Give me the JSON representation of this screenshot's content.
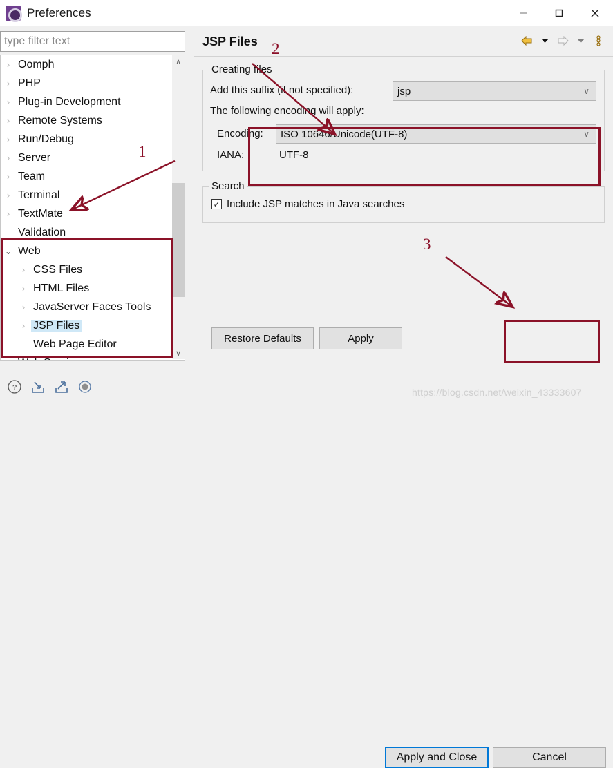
{
  "window": {
    "title": "Preferences",
    "icon": "preferences-gear-icon",
    "controls": {
      "minimize": "–",
      "maximize": "□",
      "close": "×"
    }
  },
  "filter": {
    "placeholder": "type filter text",
    "value": ""
  },
  "tree": {
    "items": [
      {
        "label": "Oomph",
        "level": 0,
        "arrow": "right",
        "selected": false
      },
      {
        "label": "PHP",
        "level": 0,
        "arrow": "right",
        "selected": false
      },
      {
        "label": "Plug-in Development",
        "level": 0,
        "arrow": "right",
        "selected": false
      },
      {
        "label": "Remote Systems",
        "level": 0,
        "arrow": "right",
        "selected": false
      },
      {
        "label": "Run/Debug",
        "level": 0,
        "arrow": "right",
        "selected": false
      },
      {
        "label": "Server",
        "level": 0,
        "arrow": "right",
        "selected": false
      },
      {
        "label": "Team",
        "level": 0,
        "arrow": "right",
        "selected": false
      },
      {
        "label": "Terminal",
        "level": 0,
        "arrow": "right",
        "selected": false
      },
      {
        "label": "TextMate",
        "level": 0,
        "arrow": "right",
        "selected": false
      },
      {
        "label": "Validation",
        "level": 0,
        "arrow": "none",
        "selected": false
      },
      {
        "label": "Web",
        "level": 0,
        "arrow": "down",
        "selected": false
      },
      {
        "label": "CSS Files",
        "level": 1,
        "arrow": "right",
        "selected": false
      },
      {
        "label": "HTML Files",
        "level": 1,
        "arrow": "right",
        "selected": false
      },
      {
        "label": "JavaServer Faces Tools",
        "level": 1,
        "arrow": "right",
        "selected": false
      },
      {
        "label": "JSP Files",
        "level": 1,
        "arrow": "right",
        "selected": true
      },
      {
        "label": "Web Page Editor",
        "level": 1,
        "arrow": "none",
        "selected": false
      },
      {
        "label": "Web Services",
        "level": 0,
        "arrow": "right",
        "selected": false
      }
    ],
    "scrollbar": {
      "up_glyph": "∧",
      "down_glyph": "∨"
    }
  },
  "page": {
    "title": "JSP Files",
    "nav": {
      "back_icon": "back-arrow-icon",
      "back_menu_icon": "chevron-down-icon",
      "forward_icon": "forward-arrow-icon",
      "forward_menu_icon": "chevron-down-icon",
      "menu_icon": "vertical-dots-icon"
    },
    "creating_files": {
      "legend": "Creating files",
      "suffix_label": "Add this suffix (if not specified):",
      "suffix_value": "jsp",
      "encoding_note": "The following encoding will apply:",
      "encoding_label": "Encoding:",
      "encoding_value": "ISO 10646/Unicode(UTF-8)",
      "iana_label": "IANA:",
      "iana_value": "UTF-8",
      "chevron": "∨"
    },
    "search": {
      "legend": "Search",
      "checkbox_label": "Include JSP matches in Java searches",
      "checkbox_checked": true,
      "check_glyph": "✓"
    },
    "buttons": {
      "restore_defaults": "Restore Defaults",
      "apply": "Apply"
    }
  },
  "footer": {
    "icons": [
      {
        "name": "help-icon",
        "glyph": "?"
      },
      {
        "name": "import-icon",
        "glyph": "↘"
      },
      {
        "name": "export-icon",
        "glyph": "↗"
      },
      {
        "name": "resize-grip-icon",
        "glyph": "●"
      }
    ],
    "apply_and_close": "Apply and Close",
    "cancel": "Cancel"
  },
  "annotations": {
    "markers": [
      {
        "id": "1",
        "label": "1"
      },
      {
        "id": "2",
        "label": "2"
      },
      {
        "id": "3",
        "label": "3"
      }
    ],
    "accent_color": "#8b1228",
    "watermark": "https://blog.csdn.net/weixin_43333607"
  }
}
